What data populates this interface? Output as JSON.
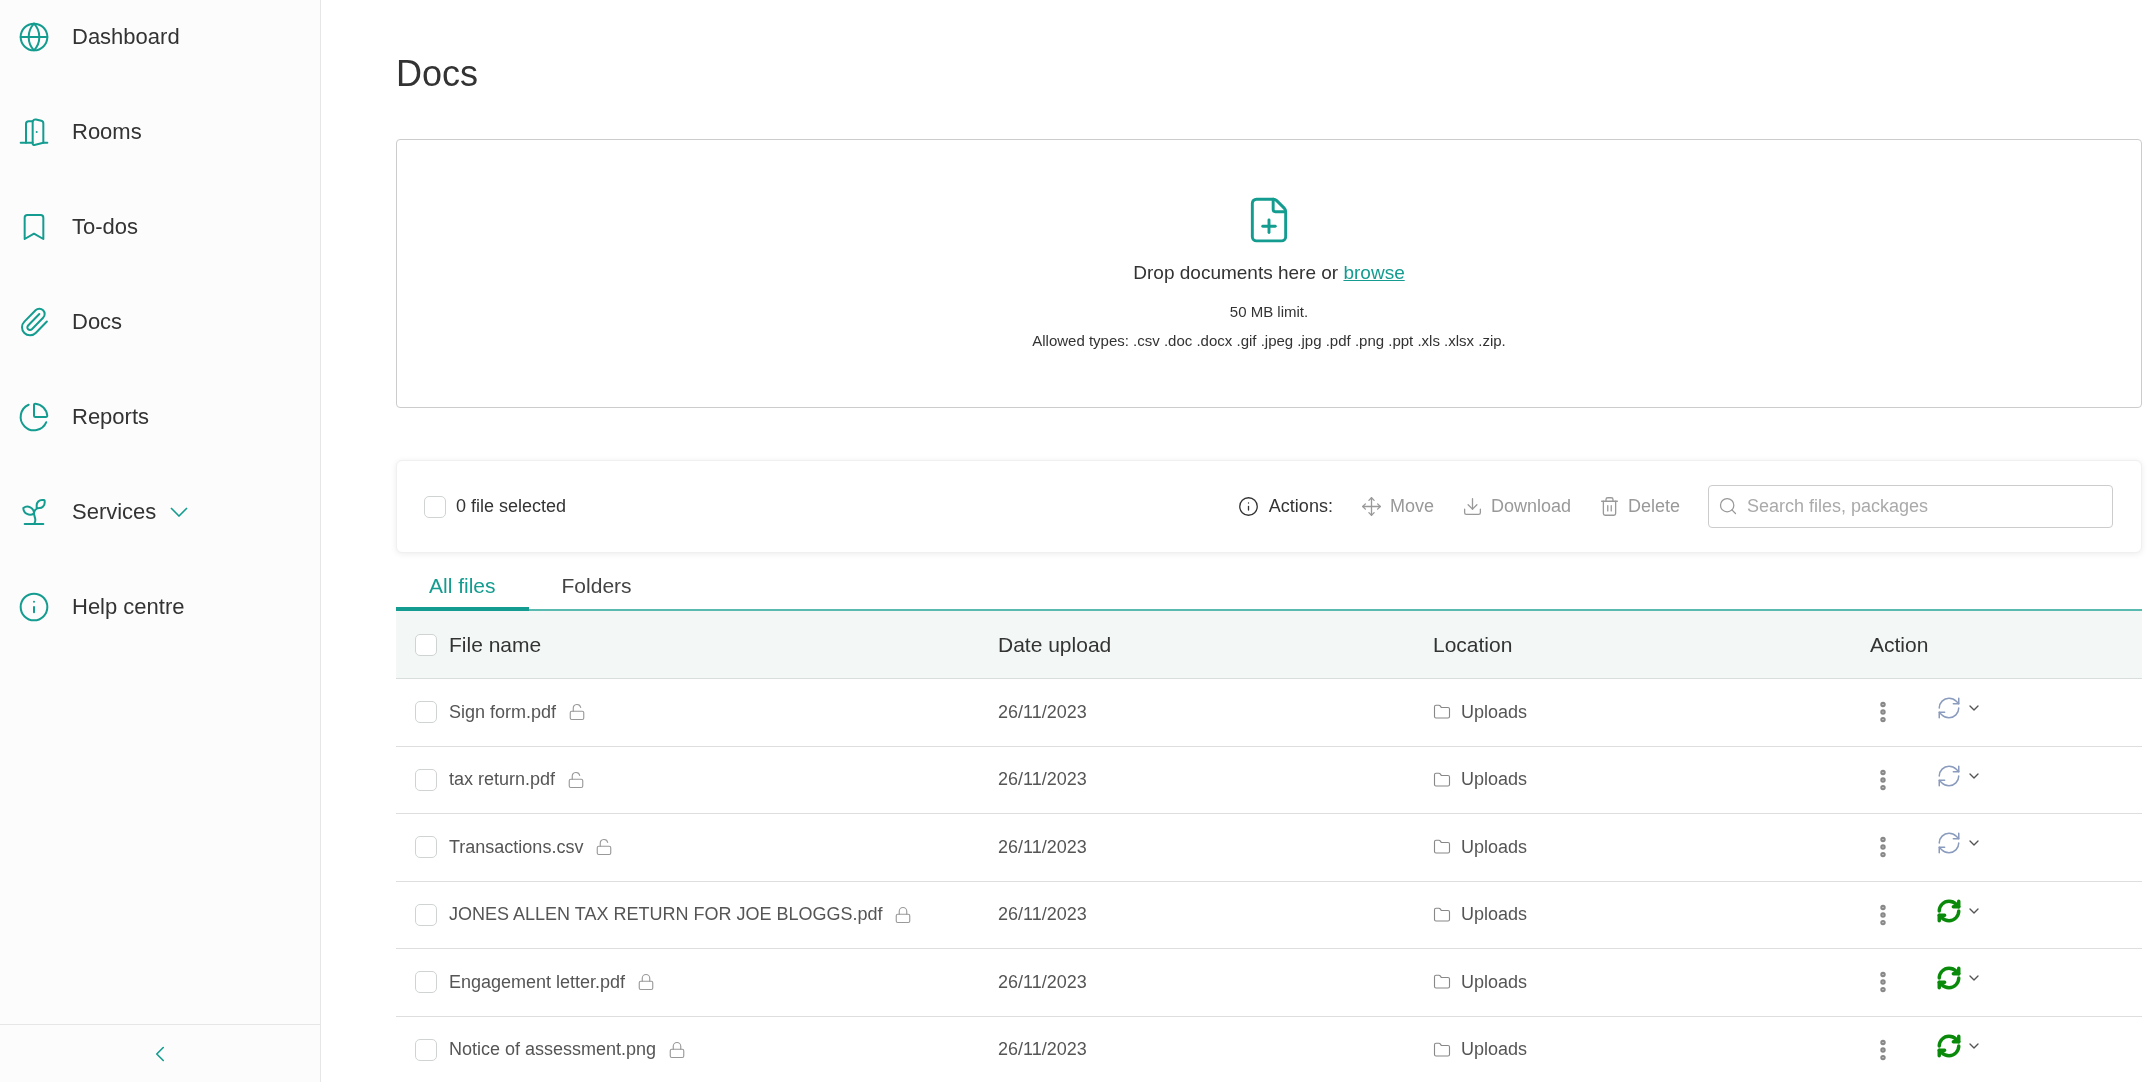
{
  "sidebar": {
    "items": [
      {
        "label": "Dashboard",
        "kind": "globe",
        "expandable": false
      },
      {
        "label": "Rooms",
        "kind": "door",
        "expandable": false
      },
      {
        "label": "To-dos",
        "kind": "bookmark",
        "expandable": false
      },
      {
        "label": "Docs",
        "kind": "clip",
        "expandable": false
      },
      {
        "label": "Reports",
        "kind": "pie",
        "expandable": false
      },
      {
        "label": "Services",
        "kind": "sprout",
        "expandable": true
      },
      {
        "label": "Help centre",
        "kind": "info",
        "expandable": false
      }
    ]
  },
  "page_title": "Docs",
  "dropzone": {
    "text_before": "Drop documents here or ",
    "link": "browse",
    "limit": "50 MB limit.",
    "allowed": "Allowed types: .csv .doc .docx .gif .jpeg .jpg .pdf .png .ppt .xls .xlsx .zip."
  },
  "toolbar": {
    "select_all_checked": false,
    "selected_count": "0 file selected",
    "actions_label": "Actions:",
    "actions": [
      {
        "kind": "move",
        "label": "Move"
      },
      {
        "kind": "download",
        "label": "Download"
      },
      {
        "kind": "delete",
        "label": "Delete"
      }
    ],
    "search": {
      "placeholder": "Search files, packages"
    }
  },
  "tabs": [
    {
      "label": "All files",
      "selected": true
    },
    {
      "label": "Folders",
      "selected": false
    }
  ],
  "table": {
    "header_checked": false,
    "columns": [
      "File name",
      "Date upload",
      "Location",
      "Action"
    ],
    "rows": [
      {
        "name": "Sign form.pdf",
        "locked": false,
        "date": "26/11/2023",
        "location": "Uploads",
        "synced": false,
        "checked": false
      },
      {
        "name": "tax return.pdf",
        "locked": false,
        "date": "26/11/2023",
        "location": "Uploads",
        "synced": false,
        "checked": false
      },
      {
        "name": "Transactions.csv",
        "locked": false,
        "date": "26/11/2023",
        "location": "Uploads",
        "synced": false,
        "checked": false
      },
      {
        "name": "JONES ALLEN TAX RETURN FOR JOE BLOGGS.pdf",
        "locked": true,
        "date": "26/11/2023",
        "location": "Uploads",
        "synced": true,
        "checked": false
      },
      {
        "name": "Engagement letter.pdf",
        "locked": true,
        "date": "26/11/2023",
        "location": "Uploads",
        "synced": true,
        "checked": false
      },
      {
        "name": "Notice of assessment.png",
        "locked": true,
        "date": "26/11/2023",
        "location": "Uploads",
        "synced": true,
        "checked": false
      }
    ]
  }
}
